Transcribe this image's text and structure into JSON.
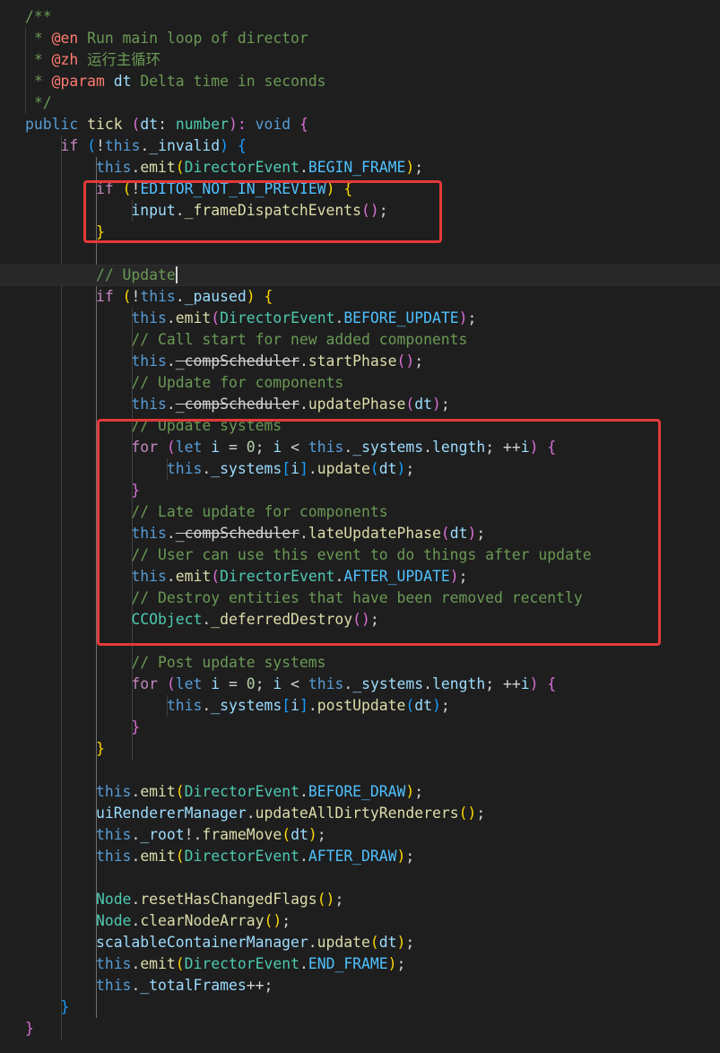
{
  "theme": {
    "background": "#1e1e1e",
    "annotation_color": "#e53939",
    "colors": {
      "comment": "#6a9955",
      "doctag": "#ff7b72",
      "keyword": "#569cd6",
      "control": "#c586c0",
      "function": "#dcdcaa",
      "type": "#4ec9b0",
      "variable": "#9cdcfe",
      "constant": "#4fc1ff",
      "number": "#b5cea8",
      "text": "#d4d4d4",
      "bracket_level1": "#ffd700",
      "bracket_level2": "#da70d6",
      "bracket_level3": "#179fff"
    }
  },
  "code": [
    [
      [
        "/**",
        "comment"
      ]
    ],
    [
      [
        " * ",
        "comment"
      ],
      [
        "@en",
        "doctag"
      ],
      [
        " Run main loop of director",
        "comment"
      ]
    ],
    [
      [
        " * ",
        "comment"
      ],
      [
        "@zh",
        "doctag"
      ],
      [
        " 运行主循环",
        "comment"
      ]
    ],
    [
      [
        " * ",
        "comment"
      ],
      [
        "@param",
        "doctag"
      ],
      [
        " ",
        "comment"
      ],
      [
        "dt",
        "variable"
      ],
      [
        " Delta time in seconds",
        "comment"
      ]
    ],
    [
      [
        " */",
        "comment"
      ]
    ],
    [
      [
        "public",
        "keyword"
      ],
      [
        " ",
        "punct"
      ],
      [
        "tick",
        "function"
      ],
      [
        " ",
        "punct"
      ],
      [
        "(",
        "bracket2"
      ],
      [
        "dt",
        "param"
      ],
      [
        ": ",
        "punct"
      ],
      [
        "number",
        "type"
      ],
      [
        "): ",
        "bracket2"
      ],
      [
        "void",
        "keyword"
      ],
      [
        " ",
        "punct"
      ],
      [
        "{",
        "bracket2"
      ]
    ],
    [
      [
        "    ",
        "punct"
      ],
      [
        "if",
        "control"
      ],
      [
        " ",
        "punct"
      ],
      [
        "(",
        "bracket3"
      ],
      [
        "!",
        "punct"
      ],
      [
        "this",
        "keyword"
      ],
      [
        ".",
        "punct"
      ],
      [
        "_invalid",
        "variable"
      ],
      [
        ")",
        "bracket3"
      ],
      [
        " ",
        "punct"
      ],
      [
        "{",
        "bracket3"
      ]
    ],
    [
      [
        "        ",
        "punct"
      ],
      [
        "this",
        "keyword"
      ],
      [
        ".",
        "punct"
      ],
      [
        "emit",
        "function"
      ],
      [
        "(",
        "bracket1"
      ],
      [
        "DirectorEvent",
        "type"
      ],
      [
        ".",
        "punct"
      ],
      [
        "BEGIN_FRAME",
        "constant"
      ],
      [
        ")",
        "bracket1"
      ],
      [
        ";",
        "punct"
      ]
    ],
    [
      [
        "        ",
        "punct"
      ],
      [
        "if",
        "control"
      ],
      [
        " ",
        "punct"
      ],
      [
        "(",
        "bracket1"
      ],
      [
        "!",
        "punct"
      ],
      [
        "EDITOR_NOT_IN_PREVIEW",
        "constant"
      ],
      [
        ")",
        "bracket1"
      ],
      [
        " ",
        "punct"
      ],
      [
        "{",
        "bracket1"
      ]
    ],
    [
      [
        "            ",
        "punct"
      ],
      [
        "input",
        "variable"
      ],
      [
        ".",
        "punct"
      ],
      [
        "_frameDispatchEvents",
        "function"
      ],
      [
        "()",
        "bracket2"
      ],
      [
        ";",
        "punct"
      ]
    ],
    [
      [
        "        ",
        "punct"
      ],
      [
        "}",
        "bracket1"
      ]
    ],
    [
      [
        "",
        "punct"
      ]
    ],
    [
      [
        "        ",
        "punct"
      ],
      [
        "// Update",
        "comment"
      ]
    ],
    [
      [
        "        ",
        "punct"
      ],
      [
        "if",
        "control"
      ],
      [
        " ",
        "punct"
      ],
      [
        "(",
        "bracket1"
      ],
      [
        "!",
        "punct"
      ],
      [
        "this",
        "keyword"
      ],
      [
        ".",
        "punct"
      ],
      [
        "_paused",
        "variable"
      ],
      [
        ")",
        "bracket1"
      ],
      [
        " ",
        "punct"
      ],
      [
        "{",
        "bracket1"
      ]
    ],
    [
      [
        "            ",
        "punct"
      ],
      [
        "this",
        "keyword"
      ],
      [
        ".",
        "punct"
      ],
      [
        "emit",
        "function"
      ],
      [
        "(",
        "bracket2"
      ],
      [
        "DirectorEvent",
        "type"
      ],
      [
        ".",
        "punct"
      ],
      [
        "BEFORE_UPDATE",
        "constant"
      ],
      [
        ")",
        "bracket2"
      ],
      [
        ";",
        "punct"
      ]
    ],
    [
      [
        "            ",
        "punct"
      ],
      [
        "// Call start for new added components",
        "comment"
      ]
    ],
    [
      [
        "            ",
        "punct"
      ],
      [
        "this",
        "keyword"
      ],
      [
        ".",
        "punct"
      ],
      [
        "_compScheduler",
        "deprecated"
      ],
      [
        ".",
        "punct"
      ],
      [
        "startPhase",
        "function"
      ],
      [
        "()",
        "bracket2"
      ],
      [
        ";",
        "punct"
      ]
    ],
    [
      [
        "            ",
        "punct"
      ],
      [
        "// Update for components",
        "comment"
      ]
    ],
    [
      [
        "            ",
        "punct"
      ],
      [
        "this",
        "keyword"
      ],
      [
        ".",
        "punct"
      ],
      [
        "_compScheduler",
        "deprecated"
      ],
      [
        ".",
        "punct"
      ],
      [
        "updatePhase",
        "function"
      ],
      [
        "(",
        "bracket2"
      ],
      [
        "dt",
        "param"
      ],
      [
        ")",
        "bracket2"
      ],
      [
        ";",
        "punct"
      ]
    ],
    [
      [
        "            ",
        "punct"
      ],
      [
        "// Update systems",
        "comment"
      ]
    ],
    [
      [
        "            ",
        "punct"
      ],
      [
        "for",
        "control"
      ],
      [
        " ",
        "punct"
      ],
      [
        "(",
        "bracket2"
      ],
      [
        "let",
        "keyword"
      ],
      [
        " ",
        "punct"
      ],
      [
        "i",
        "variable"
      ],
      [
        " = ",
        "punct"
      ],
      [
        "0",
        "number"
      ],
      [
        "; ",
        "punct"
      ],
      [
        "i",
        "variable"
      ],
      [
        " < ",
        "punct"
      ],
      [
        "this",
        "keyword"
      ],
      [
        ".",
        "punct"
      ],
      [
        "_systems",
        "variable"
      ],
      [
        ".",
        "punct"
      ],
      [
        "length",
        "variable"
      ],
      [
        "; ++",
        "punct"
      ],
      [
        "i",
        "variable"
      ],
      [
        ")",
        "bracket2"
      ],
      [
        " ",
        "punct"
      ],
      [
        "{",
        "bracket2"
      ]
    ],
    [
      [
        "                ",
        "punct"
      ],
      [
        "this",
        "keyword"
      ],
      [
        ".",
        "punct"
      ],
      [
        "_systems",
        "variable"
      ],
      [
        "[",
        "bracket3"
      ],
      [
        "i",
        "variable"
      ],
      [
        "]",
        "bracket3"
      ],
      [
        ".",
        "punct"
      ],
      [
        "update",
        "function"
      ],
      [
        "(",
        "bracket3"
      ],
      [
        "dt",
        "param"
      ],
      [
        ")",
        "bracket3"
      ],
      [
        ";",
        "punct"
      ]
    ],
    [
      [
        "            ",
        "punct"
      ],
      [
        "}",
        "bracket2"
      ]
    ],
    [
      [
        "            ",
        "punct"
      ],
      [
        "// Late update for components",
        "comment"
      ]
    ],
    [
      [
        "            ",
        "punct"
      ],
      [
        "this",
        "keyword"
      ],
      [
        ".",
        "punct"
      ],
      [
        "_compScheduler",
        "deprecated"
      ],
      [
        ".",
        "punct"
      ],
      [
        "lateUpdatePhase",
        "function"
      ],
      [
        "(",
        "bracket2"
      ],
      [
        "dt",
        "param"
      ],
      [
        ")",
        "bracket2"
      ],
      [
        ";",
        "punct"
      ]
    ],
    [
      [
        "            ",
        "punct"
      ],
      [
        "// User can use this event to do things after update",
        "comment"
      ]
    ],
    [
      [
        "            ",
        "punct"
      ],
      [
        "this",
        "keyword"
      ],
      [
        ".",
        "punct"
      ],
      [
        "emit",
        "function"
      ],
      [
        "(",
        "bracket2"
      ],
      [
        "DirectorEvent",
        "type"
      ],
      [
        ".",
        "punct"
      ],
      [
        "AFTER_UPDATE",
        "constant"
      ],
      [
        ")",
        "bracket2"
      ],
      [
        ";",
        "punct"
      ]
    ],
    [
      [
        "            ",
        "punct"
      ],
      [
        "// Destroy entities that have been removed recently",
        "comment"
      ]
    ],
    [
      [
        "            ",
        "punct"
      ],
      [
        "CCObject",
        "type"
      ],
      [
        ".",
        "punct"
      ],
      [
        "_deferredDestroy",
        "function"
      ],
      [
        "()",
        "bracket2"
      ],
      [
        ";",
        "punct"
      ]
    ],
    [
      [
        "",
        "punct"
      ]
    ],
    [
      [
        "            ",
        "punct"
      ],
      [
        "// Post update systems",
        "comment"
      ]
    ],
    [
      [
        "            ",
        "punct"
      ],
      [
        "for",
        "control"
      ],
      [
        " ",
        "punct"
      ],
      [
        "(",
        "bracket2"
      ],
      [
        "let",
        "keyword"
      ],
      [
        " ",
        "punct"
      ],
      [
        "i",
        "variable"
      ],
      [
        " = ",
        "punct"
      ],
      [
        "0",
        "number"
      ],
      [
        "; ",
        "punct"
      ],
      [
        "i",
        "variable"
      ],
      [
        " < ",
        "punct"
      ],
      [
        "this",
        "keyword"
      ],
      [
        ".",
        "punct"
      ],
      [
        "_systems",
        "variable"
      ],
      [
        ".",
        "punct"
      ],
      [
        "length",
        "variable"
      ],
      [
        "; ++",
        "punct"
      ],
      [
        "i",
        "variable"
      ],
      [
        ")",
        "bracket2"
      ],
      [
        " ",
        "punct"
      ],
      [
        "{",
        "bracket2"
      ]
    ],
    [
      [
        "                ",
        "punct"
      ],
      [
        "this",
        "keyword"
      ],
      [
        ".",
        "punct"
      ],
      [
        "_systems",
        "variable"
      ],
      [
        "[",
        "bracket3"
      ],
      [
        "i",
        "variable"
      ],
      [
        "]",
        "bracket3"
      ],
      [
        ".",
        "punct"
      ],
      [
        "postUpdate",
        "function"
      ],
      [
        "(",
        "bracket3"
      ],
      [
        "dt",
        "param"
      ],
      [
        ")",
        "bracket3"
      ],
      [
        ";",
        "punct"
      ]
    ],
    [
      [
        "            ",
        "punct"
      ],
      [
        "}",
        "bracket2"
      ]
    ],
    [
      [
        "        ",
        "punct"
      ],
      [
        "}",
        "bracket1"
      ]
    ],
    [
      [
        "",
        "punct"
      ]
    ],
    [
      [
        "        ",
        "punct"
      ],
      [
        "this",
        "keyword"
      ],
      [
        ".",
        "punct"
      ],
      [
        "emit",
        "function"
      ],
      [
        "(",
        "bracket1"
      ],
      [
        "DirectorEvent",
        "type"
      ],
      [
        ".",
        "punct"
      ],
      [
        "BEFORE_DRAW",
        "constant"
      ],
      [
        ")",
        "bracket1"
      ],
      [
        ";",
        "punct"
      ]
    ],
    [
      [
        "        ",
        "punct"
      ],
      [
        "uiRendererManager",
        "variable"
      ],
      [
        ".",
        "punct"
      ],
      [
        "updateAllDirtyRenderers",
        "function"
      ],
      [
        "()",
        "bracket1"
      ],
      [
        ";",
        "punct"
      ]
    ],
    [
      [
        "        ",
        "punct"
      ],
      [
        "this",
        "keyword"
      ],
      [
        ".",
        "punct"
      ],
      [
        "_root",
        "variable"
      ],
      [
        "!.",
        "punct"
      ],
      [
        "frameMove",
        "function"
      ],
      [
        "(",
        "bracket1"
      ],
      [
        "dt",
        "param"
      ],
      [
        ")",
        "bracket1"
      ],
      [
        ";",
        "punct"
      ]
    ],
    [
      [
        "        ",
        "punct"
      ],
      [
        "this",
        "keyword"
      ],
      [
        ".",
        "punct"
      ],
      [
        "emit",
        "function"
      ],
      [
        "(",
        "bracket1"
      ],
      [
        "DirectorEvent",
        "type"
      ],
      [
        ".",
        "punct"
      ],
      [
        "AFTER_DRAW",
        "constant"
      ],
      [
        ")",
        "bracket1"
      ],
      [
        ";",
        "punct"
      ]
    ],
    [
      [
        "",
        "punct"
      ]
    ],
    [
      [
        "        ",
        "punct"
      ],
      [
        "Node",
        "type"
      ],
      [
        ".",
        "punct"
      ],
      [
        "resetHasChangedFlags",
        "function"
      ],
      [
        "()",
        "bracket1"
      ],
      [
        ";",
        "punct"
      ]
    ],
    [
      [
        "        ",
        "punct"
      ],
      [
        "Node",
        "type"
      ],
      [
        ".",
        "punct"
      ],
      [
        "clearNodeArray",
        "function"
      ],
      [
        "()",
        "bracket1"
      ],
      [
        ";",
        "punct"
      ]
    ],
    [
      [
        "        ",
        "punct"
      ],
      [
        "scalableContainerManager",
        "variable"
      ],
      [
        ".",
        "punct"
      ],
      [
        "update",
        "function"
      ],
      [
        "(",
        "bracket1"
      ],
      [
        "dt",
        "param"
      ],
      [
        ")",
        "bracket1"
      ],
      [
        ";",
        "punct"
      ]
    ],
    [
      [
        "        ",
        "punct"
      ],
      [
        "this",
        "keyword"
      ],
      [
        ".",
        "punct"
      ],
      [
        "emit",
        "function"
      ],
      [
        "(",
        "bracket1"
      ],
      [
        "DirectorEvent",
        "type"
      ],
      [
        ".",
        "punct"
      ],
      [
        "END_FRAME",
        "constant"
      ],
      [
        ")",
        "bracket1"
      ],
      [
        ";",
        "punct"
      ]
    ],
    [
      [
        "        ",
        "punct"
      ],
      [
        "this",
        "keyword"
      ],
      [
        ".",
        "punct"
      ],
      [
        "_totalFrames",
        "variable"
      ],
      [
        "++;",
        "punct"
      ]
    ],
    [
      [
        "    ",
        "punct"
      ],
      [
        "}",
        "bracket3"
      ]
    ],
    [
      [
        "}",
        "bracket2"
      ]
    ]
  ]
}
